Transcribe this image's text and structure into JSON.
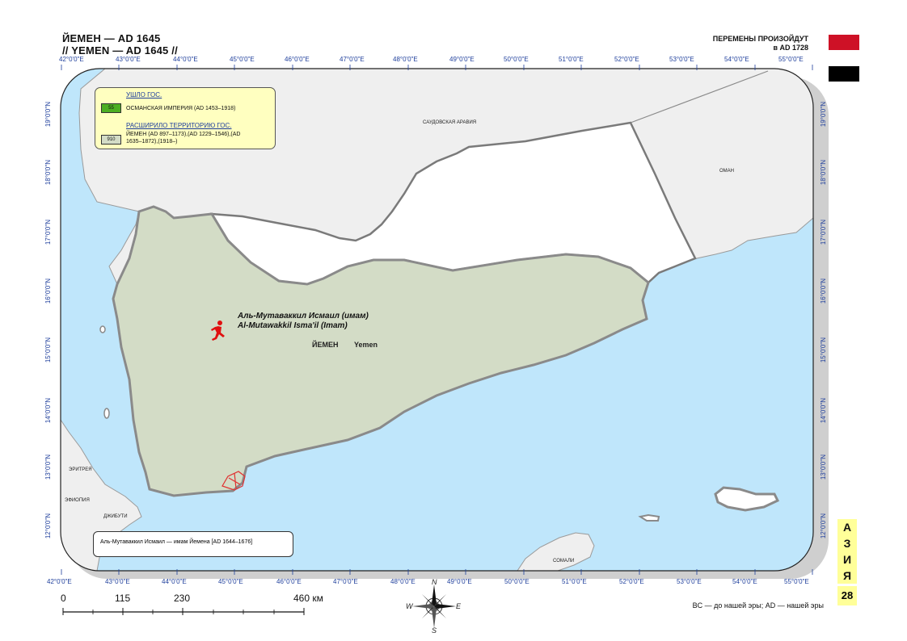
{
  "header": {
    "title_ru": "ЙЕМЕН — AD 1645",
    "title_en": "// YEMEN — AD 1645 //",
    "changes_line1": "ПЕРЕМЕНЫ ПРОИЗОЙДУТ",
    "changes_line2": "в AD 1728"
  },
  "flag": {
    "colors": [
      "#ce1126",
      "#ffffff",
      "#000000"
    ]
  },
  "axes": {
    "top_lon": [
      "42°0'0\"E",
      "43°0'0\"E",
      "44°0'0\"E",
      "45°0'0\"E",
      "46°0'0\"E",
      "47°0'0\"E",
      "48°0'0\"E",
      "49°0'0\"E",
      "50°0'0\"E",
      "51°0'0\"E",
      "52°0'0\"E",
      "53°0'0\"E",
      "54°0'0\"E",
      "55°0'0\"E"
    ],
    "bottom_lon": [
      "42°0'0\"E",
      "43°0'0\"E",
      "44°0'0\"E",
      "45°0'0\"E",
      "46°0'0\"E",
      "47°0'0\"E",
      "48°0'0\"E",
      "49°0'0\"E",
      "50°0'0\"E",
      "51°0'0\"E",
      "52°0'0\"E",
      "53°0'0\"E",
      "54°0'0\"E",
      "55°0'0\"E"
    ],
    "lat": [
      "19°0'0\"N",
      "18°0'0\"N",
      "17°0'0\"N",
      "16°0'0\"N",
      "15°0'0\"N",
      "14°0'0\"N",
      "13°0'0\"N",
      "12°0'0\"N"
    ]
  },
  "legend": {
    "lost_header": "УШЛО ГОС.",
    "lost_code": "55",
    "lost_text": "ОСМАНСКАЯ ИМПЕРИЯ (AD 1453–1918)",
    "gained_header": "РАСШИРИЛО ТЕРРИТОРИЮ ГОС.",
    "gained_code": "910",
    "gained_text": "ЙЕМЕН (AD 897–1173),(AD 1229–1546),(AD 1635–1872),(1918–)"
  },
  "places": {
    "saudi": "САУДОВСКАЯ АРАВИЯ",
    "oman": "ОМАН",
    "eritrea": "ЭРИТРЕЯ",
    "ethiopia": "ЭФИОПИЯ",
    "djibouti": "ДЖИБУТИ",
    "somalia": "СОМАЛИ",
    "yemen_ru": "ЙЕМЕН",
    "yemen_en": "Yemen"
  },
  "ruler": {
    "name_ru": "Аль-Мутаваккил Исмаил (имам)",
    "name_en": "Al-Mutawakkil Isma'il (Imam)"
  },
  "note_box": "Аль-Мутаваккил Исмаил — имам Йемена [AD 1644–1676]",
  "scale": {
    "ticks": [
      "0",
      "115",
      "230",
      "460 км"
    ]
  },
  "compass": {
    "n": "N",
    "s": "S",
    "e": "E",
    "w": "W"
  },
  "era_note": "BC — до нашей эры; AD — нашей эры",
  "side": {
    "region_letters": [
      "А",
      "З",
      "И",
      "Я"
    ],
    "page": "28"
  },
  "colors": {
    "sea": "#bfe6fb",
    "land_other": "#efefef",
    "yemen_fill": "#d3dcc6",
    "lost_area": "#ffffff",
    "legend_bg": "#ffffc0",
    "axis_text": "#1f3f9c"
  }
}
